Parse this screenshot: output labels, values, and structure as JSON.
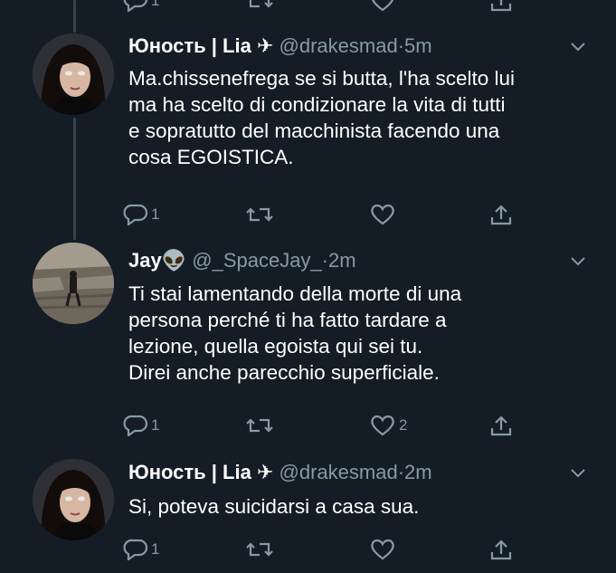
{
  "tweets": [
    {
      "name": "Юность | Lia",
      "emoji": "✈",
      "handle": "@drakesmad",
      "time": "5m",
      "lines": [
        "Ma.chissenefrega se si butta, l'ha scelto lui",
        "ma ha scelto di condizionare la vita di tutti",
        "e sopratutto del macchinista facendo una",
        "cosa EGOISTICA."
      ],
      "reply_count": "1",
      "retweet_count": "",
      "like_count": ""
    },
    {
      "name": "Jay",
      "emoji": "👽",
      "handle": "@_SpaceJay_",
      "time": "2m",
      "lines": [
        "Ti stai lamentando della morte di una",
        "persona perché ti ha fatto tardare a",
        "lezione, quella egoista qui sei tu.",
        "Direi anche parecchio superficiale."
      ],
      "reply_count": "1",
      "retweet_count": "",
      "like_count": "2"
    },
    {
      "name": "Юность | Lia",
      "emoji": "✈",
      "handle": "@drakesmad",
      "time": "2m",
      "lines": [
        "Si, poteva suicidarsi a casa sua."
      ],
      "reply_count": "1",
      "retweet_count": "",
      "like_count": ""
    }
  ],
  "top_actions": {
    "reply_count": "1"
  },
  "separator": "·",
  "colors": {
    "background": "#141d26",
    "text": "#ffffff",
    "muted": "#8899a6",
    "thread": "#38444d"
  },
  "icons": [
    "reply-icon",
    "retweet-icon",
    "like-icon",
    "share-icon",
    "chevron-down-icon",
    "plane-icon",
    "alien-icon"
  ]
}
